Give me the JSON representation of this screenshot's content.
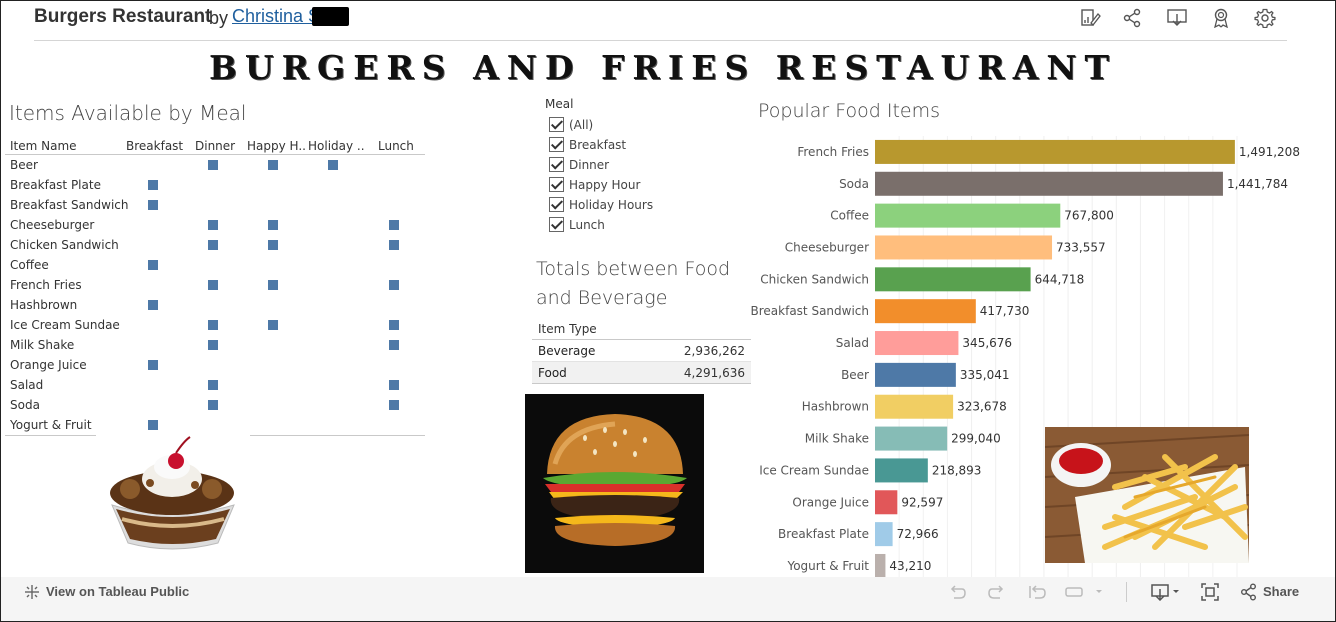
{
  "header": {
    "title": "Burgers Restaurant",
    "by": "by",
    "author": "Christina S"
  },
  "banner": "BURGERS AND FRIES RESTAURANT",
  "items_section": {
    "title": "Items Available by Meal",
    "columns": [
      "Item Name",
      "Breakfast",
      "Dinner",
      "Happy H..",
      "Holiday ..",
      "Lunch"
    ],
    "rows": [
      {
        "name": "Beer",
        "marks": [
          false,
          true,
          true,
          true,
          false
        ]
      },
      {
        "name": "Breakfast Plate",
        "marks": [
          true,
          false,
          false,
          false,
          false
        ]
      },
      {
        "name": "Breakfast Sandwich",
        "marks": [
          true,
          false,
          false,
          false,
          false
        ]
      },
      {
        "name": "Cheeseburger",
        "marks": [
          false,
          true,
          true,
          false,
          true
        ]
      },
      {
        "name": "Chicken Sandwich",
        "marks": [
          false,
          true,
          true,
          false,
          true
        ]
      },
      {
        "name": "Coffee",
        "marks": [
          true,
          false,
          false,
          false,
          false
        ]
      },
      {
        "name": "French Fries",
        "marks": [
          false,
          true,
          true,
          false,
          true
        ]
      },
      {
        "name": "Hashbrown",
        "marks": [
          true,
          false,
          false,
          false,
          false
        ]
      },
      {
        "name": "Ice Cream Sundae",
        "marks": [
          false,
          true,
          true,
          false,
          true
        ]
      },
      {
        "name": "Milk Shake",
        "marks": [
          false,
          true,
          false,
          false,
          true
        ]
      },
      {
        "name": "Orange Juice",
        "marks": [
          true,
          false,
          false,
          false,
          false
        ]
      },
      {
        "name": "Salad",
        "marks": [
          false,
          true,
          false,
          false,
          true
        ]
      },
      {
        "name": "Soda",
        "marks": [
          false,
          true,
          false,
          false,
          true
        ]
      },
      {
        "name": "Yogurt & Fruit",
        "marks": [
          true,
          false,
          false,
          false,
          false
        ]
      }
    ]
  },
  "filter": {
    "title": "Meal",
    "options": [
      "(All)",
      "Breakfast",
      "Dinner",
      "Happy Hour",
      "Holiday Hours",
      "Lunch"
    ],
    "checked": [
      true,
      true,
      true,
      true,
      true,
      true
    ]
  },
  "totals": {
    "title": "Totals between Food and Beverage",
    "header": "Item Type",
    "rows": [
      {
        "name": "Beverage",
        "value": "2,936,262"
      },
      {
        "name": "Food",
        "value": "4,291,636"
      }
    ]
  },
  "chart_data": {
    "type": "bar",
    "orientation": "horizontal",
    "title": "Popular Food Items",
    "categories": [
      "French Fries",
      "Soda",
      "Coffee",
      "Cheeseburger",
      "Chicken Sandwich",
      "Breakfast Sandwich",
      "Salad",
      "Beer",
      "Hashbrown",
      "Milk Shake",
      "Ice Cream Sundae",
      "Orange Juice",
      "Breakfast Plate",
      "Yogurt & Fruit"
    ],
    "values": [
      1491208,
      1441784,
      767800,
      733557,
      644718,
      417730,
      345676,
      335041,
      323678,
      299040,
      218893,
      92597,
      72966,
      43210
    ],
    "value_labels": [
      "1,491,208",
      "1,441,784",
      "767,800",
      "733,557",
      "644,718",
      "417,730",
      "345,676",
      "335,041",
      "323,678",
      "299,040",
      "218,893",
      "92,597",
      "72,966",
      "43,210"
    ],
    "colors": [
      "#b8982e",
      "#7a6f6b",
      "#8cd17d",
      "#ffbe7d",
      "#59a14f",
      "#f28e2b",
      "#ff9d9a",
      "#4e79a7",
      "#f1ce63",
      "#86bcb6",
      "#499894",
      "#e15759",
      "#a0cbe8",
      "#bab0ac"
    ],
    "xlim": [
      0,
      1500000
    ],
    "grid": true
  },
  "footer": {
    "view_label": "View on Tableau Public",
    "share_label": "Share"
  },
  "icons": {
    "edit": "edit-icon",
    "share": "share-icon",
    "download": "download-icon",
    "favorite": "badge-icon",
    "settings": "gear-icon"
  }
}
